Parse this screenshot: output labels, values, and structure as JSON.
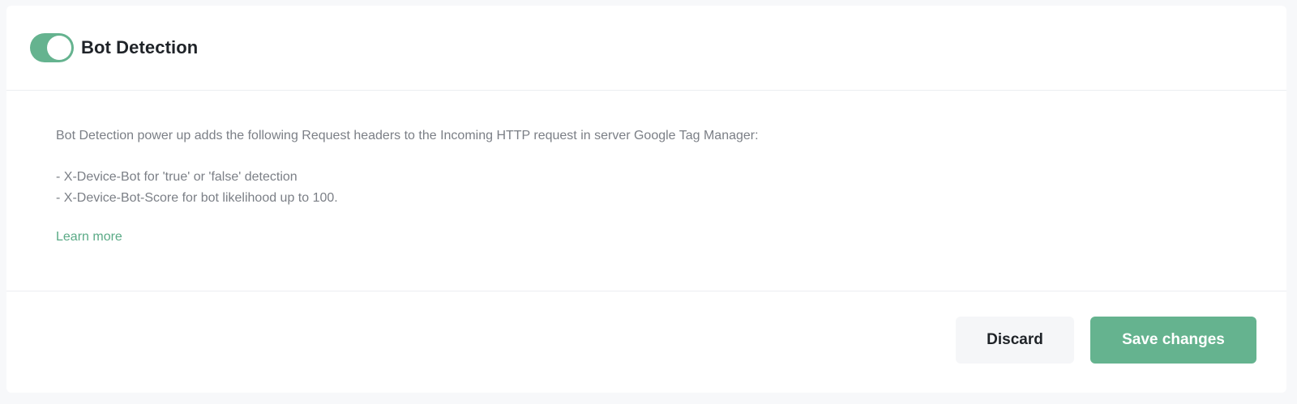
{
  "header": {
    "toggle_state": "on",
    "title": "Bot Detection"
  },
  "body": {
    "description": "Bot Detection power up adds the following Request headers to the Incoming HTTP request in server Google Tag Manager:",
    "bullets": [
      "- X-Device-Bot for 'true' or 'false' detection",
      "- X-Device-Bot-Score for bot likelihood up to 100."
    ],
    "learn_more": "Learn more"
  },
  "footer": {
    "discard_label": "Discard",
    "save_label": "Save changes"
  },
  "colors": {
    "accent": "#65b38f",
    "link": "#5aaa86",
    "text_muted": "#7b7f86",
    "title": "#1f2328",
    "background": "#f7f8fa"
  }
}
